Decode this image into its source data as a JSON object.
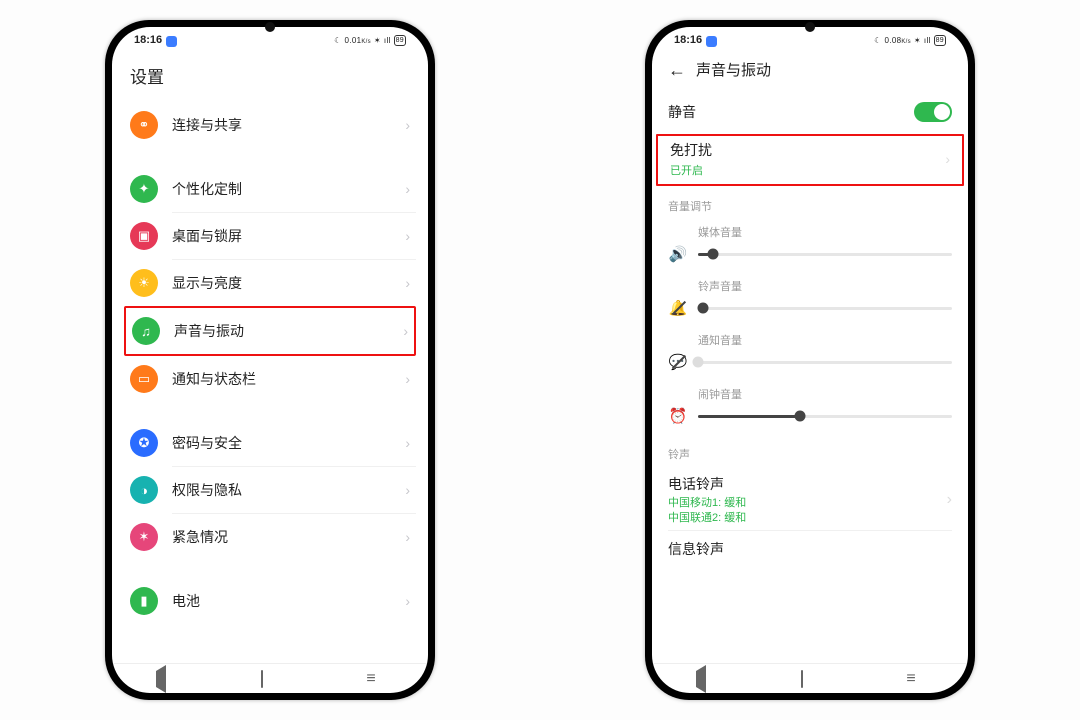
{
  "status": {
    "time": "18:16",
    "battery": "89",
    "net_up": "0.01",
    "net_up2": "0.08",
    "net_unit": "K/s"
  },
  "left": {
    "title": "设置",
    "rows": [
      {
        "label": "连接与共享",
        "icon": "share-icon",
        "color": "ic-orange",
        "glyph": "⚭"
      },
      {
        "label": "个性化定制",
        "icon": "palette-icon",
        "color": "ic-green",
        "glyph": "✦"
      },
      {
        "label": "桌面与锁屏",
        "icon": "home-lock-icon",
        "color": "ic-pink",
        "glyph": "▣"
      },
      {
        "label": "显示与亮度",
        "icon": "brightness-icon",
        "color": "ic-yellow",
        "glyph": "☀"
      },
      {
        "label": "声音与振动",
        "icon": "sound-icon",
        "color": "ic-green2",
        "glyph": "♫"
      },
      {
        "label": "通知与状态栏",
        "icon": "notification-icon",
        "color": "ic-orange2",
        "glyph": "▭"
      },
      {
        "label": "密码与安全",
        "icon": "security-icon",
        "color": "ic-blue",
        "glyph": "✪"
      },
      {
        "label": "权限与隐私",
        "icon": "privacy-icon",
        "color": "ic-teal",
        "glyph": "◑"
      },
      {
        "label": "紧急情况",
        "icon": "sos-icon",
        "color": "ic-rose",
        "glyph": "✶"
      },
      {
        "label": "电池",
        "icon": "battery-icon",
        "color": "ic-green3",
        "glyph": "▮"
      }
    ]
  },
  "right": {
    "title": "声音与振动",
    "silent_label": "静音",
    "silent_on": true,
    "dnd_title": "免打扰",
    "dnd_status": "已开启",
    "vol_header": "音量调节",
    "sliders": [
      {
        "label": "媒体音量",
        "icon": "speaker-icon",
        "value": 6,
        "muted": false,
        "disabled": false
      },
      {
        "label": "铃声音量",
        "icon": "ring-mute-icon",
        "value": 2,
        "muted": true,
        "disabled": false
      },
      {
        "label": "通知音量",
        "icon": "notify-mute-icon",
        "value": 0,
        "muted": true,
        "disabled": true
      },
      {
        "label": "闹钟音量",
        "icon": "alarm-icon",
        "value": 40,
        "muted": false,
        "disabled": false
      }
    ],
    "ring_header": "铃声",
    "phone_ring_title": "电话铃声",
    "phone_ring_sub1": "中国移动1: 缓和",
    "phone_ring_sub2": "中国联通2: 缓和",
    "msg_ring_title": "信息铃声"
  }
}
